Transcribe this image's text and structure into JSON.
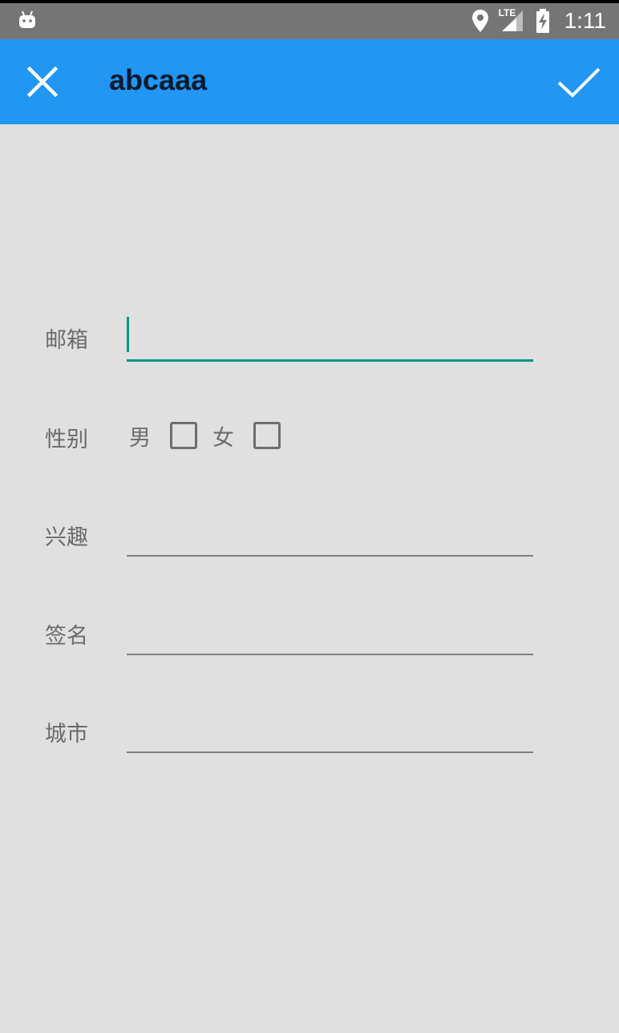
{
  "status_bar": {
    "time": "1:11",
    "network": "LTE",
    "icons": [
      "android-icon",
      "location-icon",
      "signal-icon",
      "battery-charging-icon"
    ]
  },
  "app_bar": {
    "title": "abcaaa",
    "close_icon": "close-icon",
    "confirm_icon": "check-icon",
    "background": "#2196f3"
  },
  "form": {
    "email": {
      "label": "邮箱",
      "value": "",
      "placeholder": ""
    },
    "gender": {
      "label": "性别",
      "male_label": "男",
      "female_label": "女",
      "male_checked": false,
      "female_checked": false
    },
    "hobby": {
      "label": "兴趣",
      "value": ""
    },
    "signature": {
      "label": "签名",
      "value": ""
    },
    "city": {
      "label": "城市",
      "value": ""
    }
  },
  "colors": {
    "accent": "#00968a",
    "background": "#e0e0e0",
    "status_bar": "#757575"
  }
}
